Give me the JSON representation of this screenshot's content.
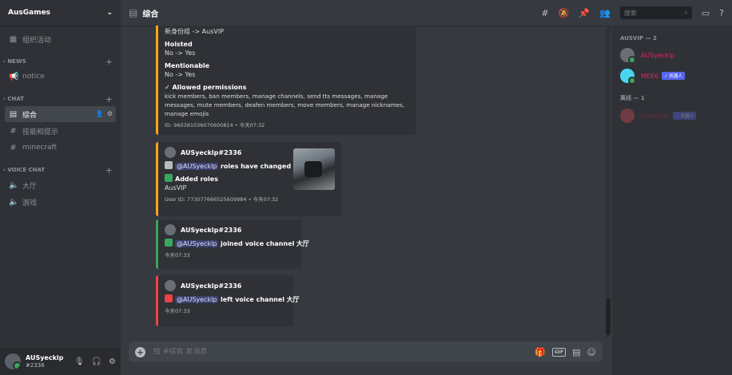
{
  "server": {
    "name": "AusGames"
  },
  "channels": {
    "top": [
      {
        "label": "组织活动",
        "icon": "calendar-icon"
      }
    ],
    "categories": [
      {
        "label": "NEWS",
        "items": [
          {
            "label": "notice",
            "icon": "megaphone-icon"
          }
        ]
      },
      {
        "label": "CHAT",
        "items": [
          {
            "label": "综合",
            "icon": "text-channel-icon",
            "active": true
          },
          {
            "label": "技能和提示",
            "icon": "hash-icon"
          },
          {
            "label": "minecraft",
            "icon": "hash-icon"
          }
        ]
      },
      {
        "label": "VOICE CHAT",
        "items": [
          {
            "label": "大厅",
            "icon": "speaker-icon"
          },
          {
            "label": "游戏",
            "icon": "speaker-icon"
          }
        ]
      }
    ]
  },
  "user": {
    "name": "AUSyecklp",
    "discriminator": "#2336"
  },
  "header": {
    "channel": "综合",
    "search_placeholder": "搜索"
  },
  "messages": {
    "embed1": {
      "line_top": "新身份组 -> AusVIP",
      "hoisted_label": "Hoisted",
      "hoisted_value": "No -> Yes",
      "mentionable_label": "Mentionable",
      "mentionable_value": "No -> Yes",
      "perms_label": "✓ Allowed permissions",
      "perms_value": "kick members, ban members, manage channels, send tts messages, manage messages, mute members, deafen members, move members, manage nicknames, manage emojis",
      "footer": "ID: 960381036070600814 • 今天07:32",
      "color": "#faa61a"
    },
    "embed2": {
      "author": "AUSyecklp#2336",
      "mention": "@AUSyecklp",
      "action": "roles have changed",
      "added_label": "Added roles",
      "added_value": "AusVIP",
      "footer": "User ID: 773077666525609984 • 今天07:32",
      "color": "#faa61a"
    },
    "embed3": {
      "author": "AUSyecklp#2336",
      "mention": "@AUSyecklp",
      "action": "joined voice channel",
      "channel": "大厅",
      "footer": "今天07:33",
      "color": "#3ba55d"
    },
    "embed4": {
      "author": "AUSyecklp#2336",
      "mention": "@AUSyecklp",
      "action": "left voice channel",
      "channel": "大厅",
      "footer": "今天07:33",
      "color": "#ed4245"
    }
  },
  "composer": {
    "placeholder": "给 #综合 发消息",
    "gif": "GIF"
  },
  "members": {
    "groups": [
      {
        "label": "AUSVIP — 2",
        "items": [
          {
            "name": "AUSyecklp",
            "color": "#e91e63",
            "tag": ""
          },
          {
            "name": "MEE6",
            "color": "#e91e63",
            "tag": "✓ 机器人"
          }
        ]
      },
      {
        "label": "离线 — 1",
        "items": [
          {
            "name": "Pokemon",
            "color": "#e91e63",
            "tag": "✓ 机器人"
          }
        ]
      }
    ]
  }
}
